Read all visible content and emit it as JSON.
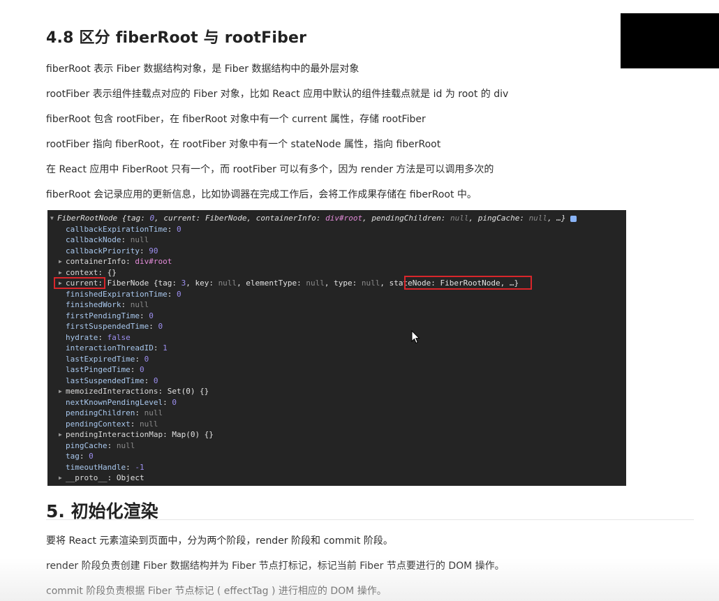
{
  "section_48": {
    "title": "4.8 区分 fiberRoot 与 rootFiber",
    "paragraphs": [
      "fiberRoot 表示 Fiber 数据结构对象，是 Fiber 数据结构中的最外层对象",
      "rootFiber 表示组件挂载点对应的 Fiber 对象，比如 React 应用中默认的组件挂载点就是 id 为 root 的 div",
      "fiberRoot 包含 rootFiber，在 fiberRoot 对象中有一个 current 属性，存储 rootFiber",
      "rootFiber 指向 fiberRoot，在 rootFiber 对象中有一个 stateNode 属性，指向 fiberRoot",
      "在 React 应用中 FiberRoot 只有一个，而 rootFiber 可以有多个，因为 render 方法是可以调用多次的",
      "fiberRoot 会记录应用的更新信息，比如协调器在完成工作后，会将工作成果存储在 fiberRoot 中。"
    ]
  },
  "console": {
    "header": {
      "name": "FiberRootNode",
      "summary_prefix": " {tag: ",
      "tag": "0",
      "current_key": ", current: ",
      "current_val": "FiberNode",
      "container_key": ", containerInfo: ",
      "container_val": "div#root",
      "pending_key": ", pendingChildren: ",
      "pending_val": "null",
      "ping_key": ", pingCache: ",
      "ping_val": "null",
      "suffix": ", …}"
    },
    "rows": {
      "callbackExpirationTime": {
        "key": "callbackExpirationTime",
        "value": "0"
      },
      "callbackNode": {
        "key": "callbackNode",
        "value": "null"
      },
      "callbackPriority": {
        "key": "callbackPriority",
        "value": "90"
      },
      "containerInfo": {
        "key": "containerInfo",
        "value": "div#root"
      },
      "context": {
        "key": "context",
        "value": "{}"
      },
      "current": {
        "key": "current",
        "name": "FiberNode",
        "pre": " {tag: ",
        "tag": "3",
        "key_label": ", key: ",
        "key_val": "null",
        "elementType_label": ", elementType: ",
        "elementType_val": "null",
        "type_label": ", type: ",
        "type_val": "null",
        "statenode_text": "stateNode: FiberRootNode,",
        "suffix": " …}"
      },
      "finishedExpirationTime": {
        "key": "finishedExpirationTime",
        "value": "0"
      },
      "finishedWork": {
        "key": "finishedWork",
        "value": "null"
      },
      "firstPendingTime": {
        "key": "firstPendingTime",
        "value": "0"
      },
      "firstSuspendedTime": {
        "key": "firstSuspendedTime",
        "value": "0"
      },
      "hydrate": {
        "key": "hydrate",
        "value": "false"
      },
      "interactionThreadID": {
        "key": "interactionThreadID",
        "value": "1"
      },
      "lastExpiredTime": {
        "key": "lastExpiredTime",
        "value": "0"
      },
      "lastPingedTime": {
        "key": "lastPingedTime",
        "value": "0"
      },
      "lastSuspendedTime": {
        "key": "lastSuspendedTime",
        "value": "0"
      },
      "memoizedInteractions": {
        "key": "memoizedInteractions",
        "value": "Set(0) {}"
      },
      "nextKnownPendingLevel": {
        "key": "nextKnownPendingLevel",
        "value": "0"
      },
      "pendingChildren": {
        "key": "pendingChildren",
        "value": "null"
      },
      "pendingContext": {
        "key": "pendingContext",
        "value": "null"
      },
      "pendingInteractionMap": {
        "key": "pendingInteractionMap",
        "value": "Map(0) {}"
      },
      "pingCache": {
        "key": "pingCache",
        "value": "null"
      },
      "tag": {
        "key": "tag",
        "value": "0"
      },
      "timeoutHandle": {
        "key": "timeoutHandle",
        "value": "-1"
      },
      "proto": {
        "key": "__proto__",
        "value": "Object"
      }
    }
  },
  "section_5": {
    "title": "5. 初始化渲染",
    "paragraphs": [
      "要将 React 元素渲染到页面中，分为两个阶段，render 阶段和 commit 阶段。",
      "render 阶段负责创建 Fiber 数据结构并为 Fiber 节点打标记，标记当前 Fiber 节点要进行的 DOM 操作。",
      "commit 阶段负责根据 Fiber 节点标记 ( effectTag ) 进行相应的 DOM 操作。"
    ]
  },
  "colors": {
    "console_bg": "#242424",
    "highlight_border": "#d9262b",
    "key_color": "#a9c8ee",
    "number_color": "#9d8ff0",
    "string_color": "#e38bd9"
  }
}
